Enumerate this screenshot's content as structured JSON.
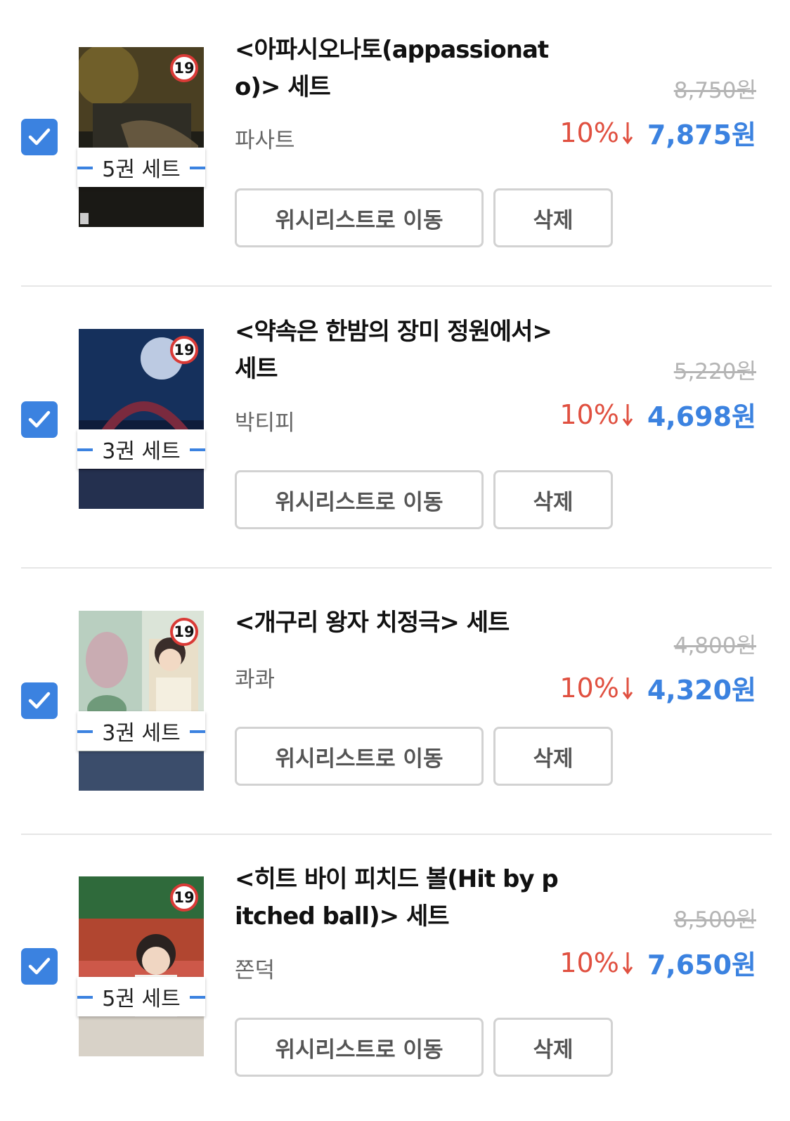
{
  "items": [
    {
      "title": "<아파시오나토(appassionato)> 세트",
      "publisher": "파사트",
      "original_price": "8,750원",
      "discount": "10%",
      "sale_price": "7,875원",
      "set_count": "5권 세트",
      "age_badge": "19",
      "checked": true,
      "wish_button": "위시리스트로 이동",
      "delete_button": "삭제",
      "cover_colors": [
        "#2c2a1c",
        "#6b5a2c",
        "#1e1d16"
      ]
    },
    {
      "title": "<약속은 한밤의 장미 정원에서> 세트",
      "publisher": "박티피",
      "original_price": "5,220원",
      "discount": "10%",
      "sale_price": "4,698원",
      "set_count": "3권 세트",
      "age_badge": "19",
      "checked": true,
      "wish_button": "위시리스트로 이동",
      "delete_button": "삭제",
      "cover_colors": [
        "#0d1d3c",
        "#1d3766",
        "#3a1826"
      ]
    },
    {
      "title": "<개구리 왕자 치정극> 세트",
      "publisher": "콰콰",
      "original_price": "4,800원",
      "discount": "10%",
      "sale_price": "4,320원",
      "set_count": "3권 세트",
      "age_badge": "19",
      "checked": true,
      "wish_button": "위시리스트로 이동",
      "delete_button": "삭제",
      "cover_colors": [
        "#c9d7c8",
        "#6f9a7a",
        "#e8d9c0"
      ]
    },
    {
      "title": "<히트 바이 피치드 볼(Hit by pitched ball)> 세트",
      "publisher": "쫀덕",
      "original_price": "8,500원",
      "discount": "10%",
      "sale_price": "7,650원",
      "set_count": "5권 세트",
      "age_badge": "19",
      "checked": true,
      "wish_button": "위시리스트로 이동",
      "delete_button": "삭제",
      "cover_colors": [
        "#2f6a3b",
        "#c8402f",
        "#e8e3dc"
      ]
    }
  ],
  "colors": {
    "accent_blue": "#3b82e0",
    "discount_red": "#e05040",
    "age_badge_red": "#d93a36"
  },
  "icons": {
    "checkbox": "check-icon",
    "discount_arrow": "arrow-down-icon"
  }
}
